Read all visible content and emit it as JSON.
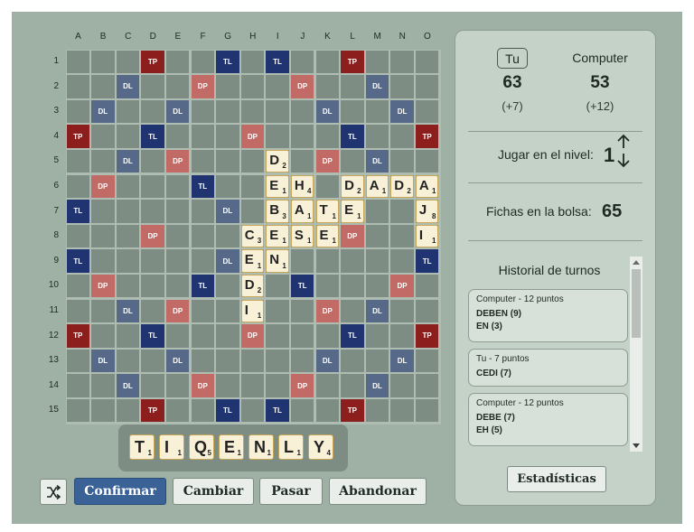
{
  "board": {
    "columns": [
      "A",
      "B",
      "C",
      "D",
      "E",
      "F",
      "G",
      "H",
      "I",
      "J",
      "K",
      "L",
      "M",
      "N",
      "O"
    ],
    "rows": [
      "1",
      "2",
      "3",
      "4",
      "5",
      "6",
      "7",
      "8",
      "9",
      "10",
      "11",
      "12",
      "13",
      "14",
      "15"
    ],
    "premium_layout": [
      "...TP...TL.TL...TP...",
      "---"
    ],
    "premium_labels": {
      "TP": "TP",
      "DP": "DP",
      "TL": "TL",
      "DL": "DL"
    },
    "premium_colors": {
      "TP": "#8c1f1d",
      "DP": "#c26a66",
      "TL": "#1f3470",
      "DL": "#566988"
    },
    "tiles": [
      {
        "row": 5,
        "col": "I",
        "letter": "D",
        "points": "2"
      },
      {
        "row": 6,
        "col": "I",
        "letter": "E",
        "points": "1"
      },
      {
        "row": 6,
        "col": "J",
        "letter": "H",
        "points": "4"
      },
      {
        "row": 6,
        "col": "L",
        "letter": "D",
        "points": "2"
      },
      {
        "row": 6,
        "col": "M",
        "letter": "A",
        "points": "1"
      },
      {
        "row": 6,
        "col": "N",
        "letter": "D",
        "points": "2"
      },
      {
        "row": 6,
        "col": "O",
        "letter": "A",
        "points": "1"
      },
      {
        "row": 7,
        "col": "I",
        "letter": "B",
        "points": "3"
      },
      {
        "row": 7,
        "col": "J",
        "letter": "A",
        "points": "1"
      },
      {
        "row": 7,
        "col": "K",
        "letter": "T",
        "points": "1"
      },
      {
        "row": 7,
        "col": "L",
        "letter": "E",
        "points": "1"
      },
      {
        "row": 7,
        "col": "O",
        "letter": "J",
        "points": "8"
      },
      {
        "row": 8,
        "col": "H",
        "letter": "C",
        "points": "3"
      },
      {
        "row": 8,
        "col": "I",
        "letter": "E",
        "points": "1"
      },
      {
        "row": 8,
        "col": "J",
        "letter": "S",
        "points": "1"
      },
      {
        "row": 8,
        "col": "K",
        "letter": "E",
        "points": "1"
      },
      {
        "row": 8,
        "col": "O",
        "letter": "I",
        "points": "1"
      },
      {
        "row": 9,
        "col": "H",
        "letter": "E",
        "points": "1"
      },
      {
        "row": 9,
        "col": "I",
        "letter": "N",
        "points": "1"
      },
      {
        "row": 10,
        "col": "H",
        "letter": "D",
        "points": "2"
      },
      {
        "row": 11,
        "col": "H",
        "letter": "I",
        "points": "1"
      }
    ]
  },
  "premiums": [
    [
      1,
      "D",
      "TP"
    ],
    [
      1,
      "G",
      "TL"
    ],
    [
      1,
      "I",
      "TL"
    ],
    [
      1,
      "L",
      "TP"
    ],
    [
      2,
      "C",
      "DL"
    ],
    [
      2,
      "F",
      "DP"
    ],
    [
      2,
      "J",
      "DP"
    ],
    [
      2,
      "M",
      "DL"
    ],
    [
      3,
      "B",
      "DL"
    ],
    [
      3,
      "E",
      "DL"
    ],
    [
      3,
      "K",
      "DL"
    ],
    [
      3,
      "N",
      "DL"
    ],
    [
      4,
      "A",
      "TP"
    ],
    [
      4,
      "D",
      "TL"
    ],
    [
      4,
      "H",
      "DP"
    ],
    [
      4,
      "L",
      "TL"
    ],
    [
      4,
      "O",
      "TP"
    ],
    [
      5,
      "C",
      "DL"
    ],
    [
      5,
      "E",
      "DP"
    ],
    [
      5,
      "K",
      "DP"
    ],
    [
      5,
      "M",
      "DL"
    ],
    [
      6,
      "B",
      "DP"
    ],
    [
      6,
      "F",
      "TL"
    ],
    [
      7,
      "A",
      "TL"
    ],
    [
      7,
      "G",
      "DL"
    ],
    [
      8,
      "D",
      "DP"
    ],
    [
      8,
      "L",
      "DP"
    ],
    [
      9,
      "A",
      "TL"
    ],
    [
      9,
      "G",
      "DL"
    ],
    [
      9,
      "O",
      "TL"
    ],
    [
      10,
      "B",
      "DP"
    ],
    [
      10,
      "F",
      "TL"
    ],
    [
      10,
      "J",
      "TL"
    ],
    [
      10,
      "N",
      "DP"
    ],
    [
      11,
      "C",
      "DL"
    ],
    [
      11,
      "E",
      "DP"
    ],
    [
      11,
      "K",
      "DP"
    ],
    [
      11,
      "M",
      "DL"
    ],
    [
      12,
      "A",
      "TP"
    ],
    [
      12,
      "D",
      "TL"
    ],
    [
      12,
      "H",
      "DP"
    ],
    [
      12,
      "L",
      "TL"
    ],
    [
      12,
      "O",
      "TP"
    ],
    [
      13,
      "B",
      "DL"
    ],
    [
      13,
      "E",
      "DL"
    ],
    [
      13,
      "K",
      "DL"
    ],
    [
      13,
      "N",
      "DL"
    ],
    [
      14,
      "C",
      "DL"
    ],
    [
      14,
      "F",
      "DP"
    ],
    [
      14,
      "J",
      "DP"
    ],
    [
      14,
      "M",
      "DL"
    ],
    [
      15,
      "D",
      "TP"
    ],
    [
      15,
      "G",
      "TL"
    ],
    [
      15,
      "I",
      "TL"
    ],
    [
      15,
      "L",
      "TP"
    ]
  ],
  "rack": [
    {
      "letter": "T",
      "points": "1"
    },
    {
      "letter": "I",
      "points": "1"
    },
    {
      "letter": "Q",
      "points": "5"
    },
    {
      "letter": "E",
      "points": "1"
    },
    {
      "letter": "N",
      "points": "1"
    },
    {
      "letter": "L",
      "points": "1"
    },
    {
      "letter": "Y",
      "points": "4"
    }
  ],
  "buttons": {
    "shuffle_icon": "shuffle-icon",
    "confirm": "Confirmar",
    "change": "Cambiar",
    "pass": "Pasar",
    "quit": "Abandonar"
  },
  "scores": {
    "you_label": "Tu",
    "computer_label": "Computer",
    "you_score": "63",
    "computer_score": "53",
    "you_delta": "(+7)",
    "computer_delta": "(+12)"
  },
  "level": {
    "label": "Jugar en el nivel:",
    "value": "1"
  },
  "bag": {
    "label": "Fichas en la bolsa:",
    "value": "65"
  },
  "history": {
    "title": "Historial de turnos",
    "turns": [
      {
        "who": "Computer - 12 puntos",
        "words": [
          "DEBEN (9)",
          "EN (3)"
        ]
      },
      {
        "who": "Tu - 7 puntos",
        "words": [
          "CEDI (7)"
        ]
      },
      {
        "who": "Computer - 12 puntos",
        "words": [
          "DEBE (7)",
          "EH (5)"
        ]
      }
    ]
  },
  "stats_button": "Estadísticas"
}
